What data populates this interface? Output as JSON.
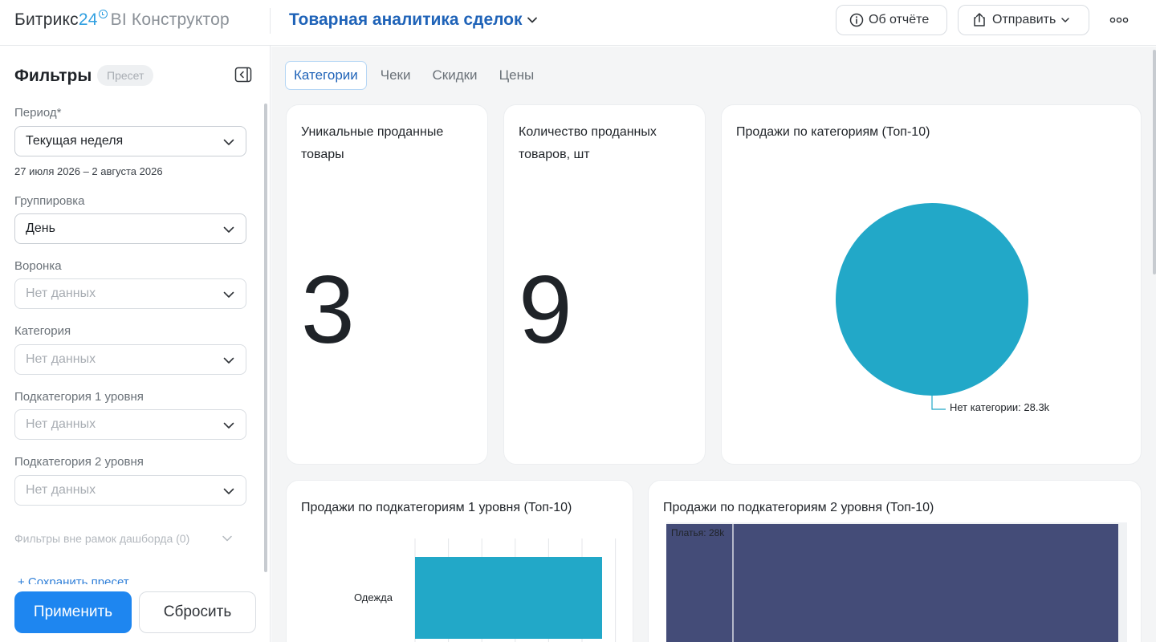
{
  "header": {
    "brand_name": "Битрикс",
    "brand_number": "24",
    "brand_product": "BI Конструктор",
    "dashboard_title": "Товарная аналитика сделок",
    "about_label": "Об отчёте",
    "send_label": "Отправить"
  },
  "sidebar": {
    "title": "Фильтры",
    "preset_badge": "Пресет",
    "period": {
      "label": "Период*",
      "value": "Текущая неделя",
      "range": "27 июля 2026 – 2 августа 2026"
    },
    "grouping": {
      "label": "Группировка",
      "value": "День"
    },
    "funnel": {
      "label": "Воронка",
      "placeholder": "Нет данных"
    },
    "category": {
      "label": "Категория",
      "placeholder": "Нет данных"
    },
    "subcat1": {
      "label": "Подкатегория 1 уровня",
      "placeholder": "Нет данных"
    },
    "subcat2": {
      "label": "Подкатегория 2 уровня",
      "placeholder": "Нет данных"
    },
    "outside_filters": "Фильтры вне рамок дашборда (0)",
    "save_preset": "+ Сохранить пресет",
    "apply_label": "Применить",
    "reset_label": "Сбросить"
  },
  "tabs": [
    {
      "label": "Категории",
      "active": true
    },
    {
      "label": "Чеки",
      "active": false
    },
    {
      "label": "Скидки",
      "active": false
    },
    {
      "label": "Цены",
      "active": false
    }
  ],
  "kpis": [
    {
      "title": "Уникальные проданные товары",
      "value": "3"
    },
    {
      "title": "Количество проданных товаров, шт",
      "value": "9"
    }
  ],
  "charts": {
    "categories": {
      "title": "Продажи по категориям (Топ-10)",
      "label": "Нет категории: 28.3k"
    },
    "subcat1": {
      "title": "Продажи по подкатегориям 1 уровня (Топ-10)",
      "category_label": "Одежда"
    },
    "subcat2": {
      "title": "Продажи по подкатегориям 2 уровня (Топ-10)",
      "tile_label": "Платья: 28k"
    }
  },
  "chart_data": [
    {
      "type": "pie",
      "title": "Продажи по категориям (Топ-10)",
      "slices": [
        {
          "label": "Нет категории",
          "value": 28300,
          "display": "28.3k"
        }
      ],
      "colors": [
        "#22a8c8"
      ]
    },
    {
      "type": "bar",
      "orientation": "horizontal",
      "title": "Продажи по подкатегориям 1 уровня (Топ-10)",
      "categories": [
        "Одежда"
      ],
      "colors": [
        "#22a8c8"
      ]
    },
    {
      "type": "treemap",
      "title": "Продажи по подкатегориям 2 уровня (Топ-10)",
      "tiles": [
        {
          "label": "Платья",
          "value": 28000,
          "display": "28k"
        }
      ],
      "colors": [
        "#444c78"
      ]
    }
  ],
  "colors": {
    "accent": "#1e86f0",
    "title_blue": "#1f63b8",
    "pie": "#22a8c8",
    "treemap": "#444c78"
  }
}
